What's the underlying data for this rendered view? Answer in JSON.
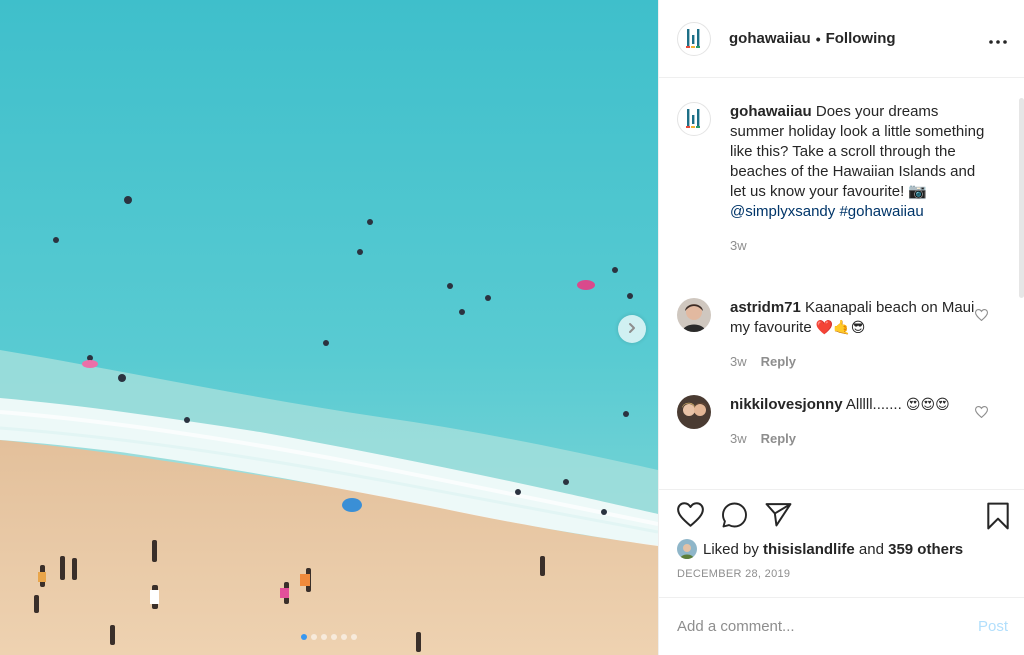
{
  "post": {
    "username": "gohawaiiau",
    "separator": "•",
    "follow_label": "Following",
    "more_icon": "more-horizontal-icon",
    "media": {
      "slide_count": 6,
      "active_slide": 1,
      "next_icon": "chevron-right-icon"
    }
  },
  "caption": {
    "username": "gohawaiiau",
    "text": "Does your dreams summer holiday look a little something like this? Take a scroll through the beaches of the Hawaiian Islands and let us know your favourite! 📷",
    "mention": "@simplyxsandy",
    "hashtag": "#gohawaiiau",
    "time": "3w"
  },
  "comments": [
    {
      "username": "astridm71",
      "text": "Kaanapali beach on Maui my favourite",
      "emojis": "❤️🤙😎",
      "time": "3w",
      "reply_label": "Reply"
    },
    {
      "username": "nikkilovesjonny",
      "text": "Alllll.......",
      "emojis": "😍😍😍",
      "time": "3w",
      "reply_label": "Reply"
    }
  ],
  "actions": {
    "like_icon": "heart-icon",
    "comment_icon": "comment-icon",
    "share_icon": "share-icon",
    "save_icon": "bookmark-icon"
  },
  "likes": {
    "prefix": "Liked by",
    "user": "thisislandlife",
    "connector": "and",
    "others": "359 others"
  },
  "date": "DECEMBER 28, 2019",
  "add_comment": {
    "placeholder": "Add a comment...",
    "post_label": "Post"
  },
  "colors": {
    "link": "#003569",
    "post_disabled": "#b2dffc",
    "active_dot": "#3897f0",
    "sea": "#49c3cc",
    "sand": "#e8c7a2"
  }
}
